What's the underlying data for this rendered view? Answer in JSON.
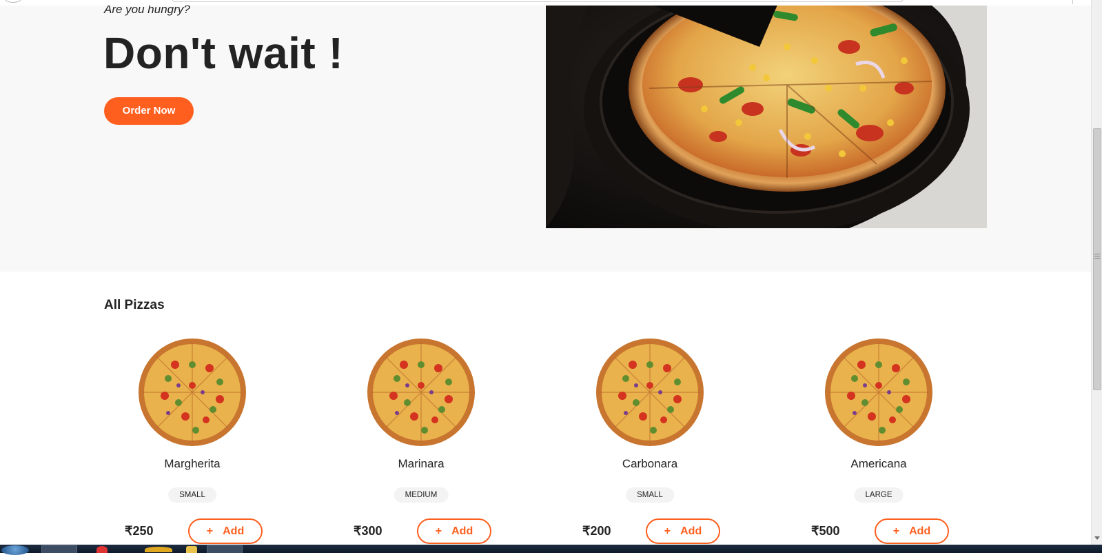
{
  "hero": {
    "tagline": "Are you hungry?",
    "title": "Don't wait !",
    "order_button": "Order Now",
    "image_icon": "pizza-photo"
  },
  "menu": {
    "section_title": "All Pizzas",
    "add_label": "Add",
    "plus_symbol": "+",
    "pizzas": [
      {
        "name": "Margherita",
        "size": "SMALL",
        "price": "₹250"
      },
      {
        "name": "Marinara",
        "size": "MEDIUM",
        "price": "₹300"
      },
      {
        "name": "Carbonara",
        "size": "SMALL",
        "price": "₹200"
      },
      {
        "name": "Americana",
        "size": "LARGE",
        "price": "₹500"
      }
    ]
  },
  "colors": {
    "accent": "#fe5f1e",
    "hero_background": "#f8f8f8",
    "text": "#232323",
    "badge_background": "#f3f3f3"
  }
}
